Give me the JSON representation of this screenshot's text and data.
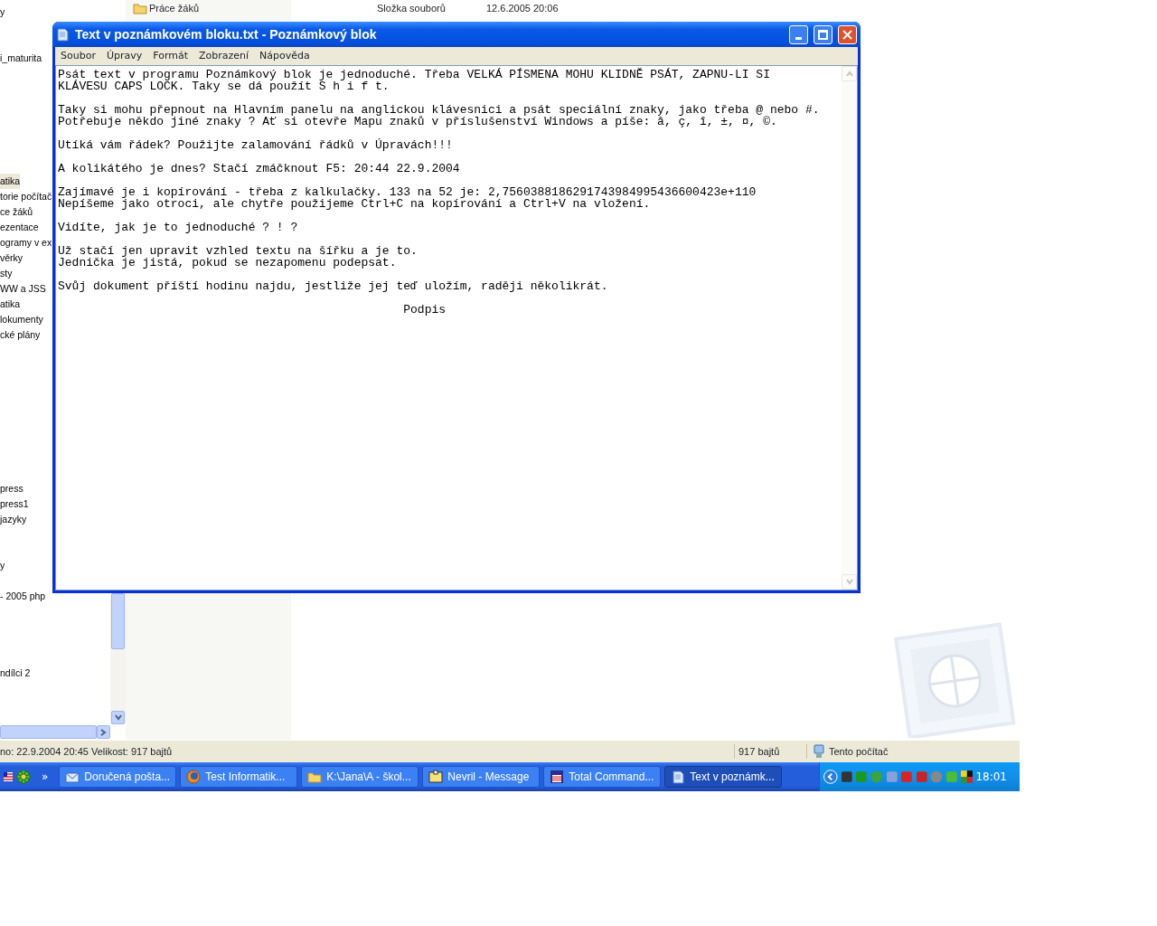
{
  "explorer": {
    "tree": [
      {
        "label": "y",
        "selected": false
      },
      {
        "label": "i_maturita",
        "selected": false
      },
      {
        "label": "atika",
        "selected": true
      },
      {
        "label": "torie počítač",
        "selected": false
      },
      {
        "label": "ce žáků",
        "selected": false
      },
      {
        "label": "ezentace",
        "selected": false
      },
      {
        "label": "ogramy v ex",
        "selected": false
      },
      {
        "label": "věrky",
        "selected": false
      },
      {
        "label": "sty",
        "selected": false
      },
      {
        "label": "WW a JSS",
        "selected": false
      },
      {
        "label": "atika",
        "selected": false
      },
      {
        "label": "lokumenty",
        "selected": false
      },
      {
        "label": "cké plány",
        "selected": false
      },
      {
        "label": "press",
        "selected": false
      },
      {
        "label": "press1",
        "selected": false
      },
      {
        "label": "jazyky",
        "selected": false
      },
      {
        "label": "y",
        "selected": false
      },
      {
        "label": "- 2005 php",
        "selected": false
      },
      {
        "label": "ndílci 2",
        "selected": false
      }
    ],
    "list_row": {
      "name": "Práce žáků",
      "type": "Složka souborů",
      "modified": "12.6.2005 20:06"
    },
    "status_bar": {
      "info": "no: 22.9.2004 20:45 Velikost: 917 bajtů",
      "size": "917 bajtů",
      "location": "Tento počítač"
    }
  },
  "notepad": {
    "title": "Text v poznámkovém bloku.txt - Poznámkový blok",
    "menu": [
      "Soubor",
      "Úpravy",
      "Formát",
      "Zobrazení",
      "Nápověda"
    ],
    "paragraphs": [
      "Psát text v programu Poznámkový blok je jednoduché. Třeba VELKÁ PÍSMENA MOHU KLIDNĚ PSÁT, ZAPNU-LI SI\nKLÁVESU CAPS LOCK. Taky se dá použít S h i f t.",
      "Taky si mohu přepnout na Hlavním panelu na anglickou klávesnici a psát speciální znaky, jako třeba @ nebo #.\nPotřebuje někdo jiné znaky ? Ať si otevře Mapu znaků v příslušenství Windows a píše: â, ç, î, ±, ¤, ©.",
      "Utíká vám řádek? Použijte zalamování řádků v Úpravách!!!",
      "A kolikátého je dnes? Stačí zmáčknout F5: 20:44 22.9.2004",
      "Zajímavé je i kopírování - třeba z kalkulačky. 133 na 52 je: 2,7560388186291743984995436600423e+110\nNepíšeme jako otroci, ale chytře použijeme Ctrl+C na kopírování a Ctrl+V na vložení.",
      "Vidíte, jak je to jednoduché ? ! ?",
      "Už stačí jen upravit vzhled textu na šířku a je to.\nJednička je jistá, pokud se nezapomenu podepsat.",
      "Svůj dokument příští hodinu najdu, jestliže jej teď uložím, raději několikrát.",
      "                                                 Podpis"
    ]
  },
  "taskbar": {
    "quick_launch_more": "»",
    "buttons": [
      {
        "label": "Doručená pošta...",
        "kind": "mail",
        "selected": false
      },
      {
        "label": "Test Informatik...",
        "kind": "browser",
        "selected": false
      },
      {
        "label": "K:\\Jana\\A - škol...",
        "kind": "folder",
        "selected": false
      },
      {
        "label": "Nevril - Message",
        "kind": "message",
        "selected": false
      },
      {
        "label": "Total Command...",
        "kind": "disk",
        "selected": false
      },
      {
        "label": "Text v poznámk...",
        "kind": "notepad",
        "selected": true
      }
    ],
    "clock": "18:01"
  }
}
